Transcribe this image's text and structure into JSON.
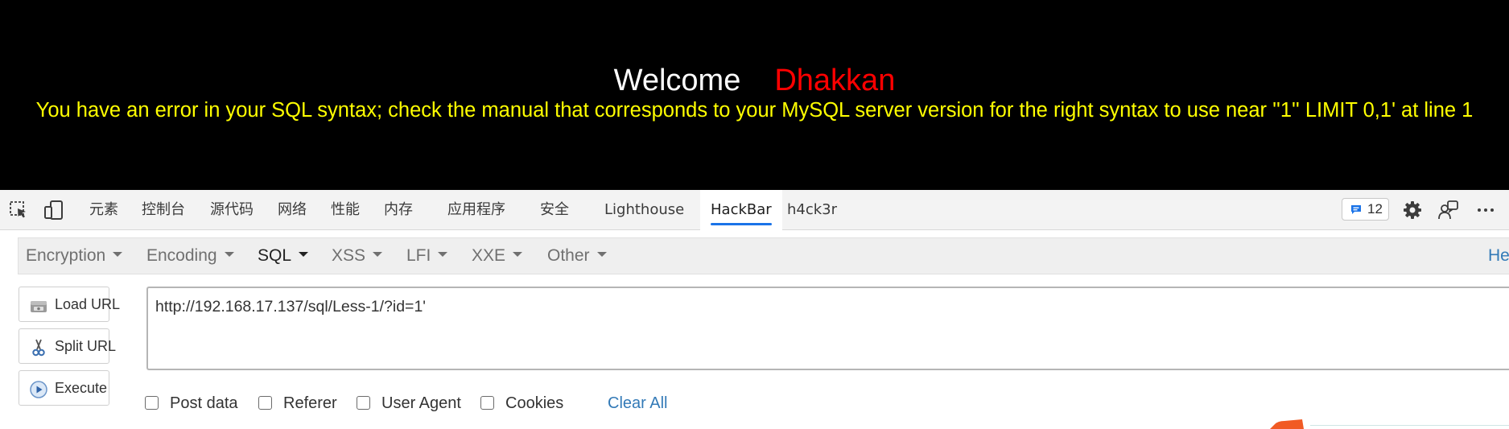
{
  "page": {
    "welcome": "Welcome",
    "name": "Dhakkan",
    "error": "You have an error in your SQL syntax; check the manual that corresponds to your MySQL server version for the right syntax to use near ''1'' LIMIT 0,1' at line 1",
    "colors": {
      "background": "#000000",
      "welcome": "#ffffff",
      "name": "#ff0000",
      "error": "#ffff00"
    }
  },
  "devtools": {
    "icons": [
      "inspect-element-icon",
      "device-toolbar-icon",
      "issues-icon",
      "settings-gear-icon",
      "feedback-icon",
      "more-options-icon"
    ],
    "tabs": [
      "元素",
      "控制台",
      "源代码",
      "网络",
      "性能",
      "内存",
      "应用程序",
      "安全",
      "Lighthouse",
      "HackBar",
      "h4ck3r"
    ],
    "active_tab": "HackBar",
    "issues_count": "12",
    "accent": "#1a73e8"
  },
  "hackbar": {
    "menu": [
      "Encryption",
      "Encoding",
      "SQL",
      "XSS",
      "LFI",
      "XXE",
      "Other"
    ],
    "selected_menu": "SQL",
    "help": "He",
    "buttons": {
      "load": "Load URL",
      "split": "Split URL",
      "execute": "Execute"
    },
    "url": "http://192.168.17.137/sql/Less-1/?id=1'",
    "options": [
      "Post data",
      "Referer",
      "User Agent",
      "Cookies"
    ],
    "clear_all": "Clear All",
    "link_color": "#337ab7"
  }
}
